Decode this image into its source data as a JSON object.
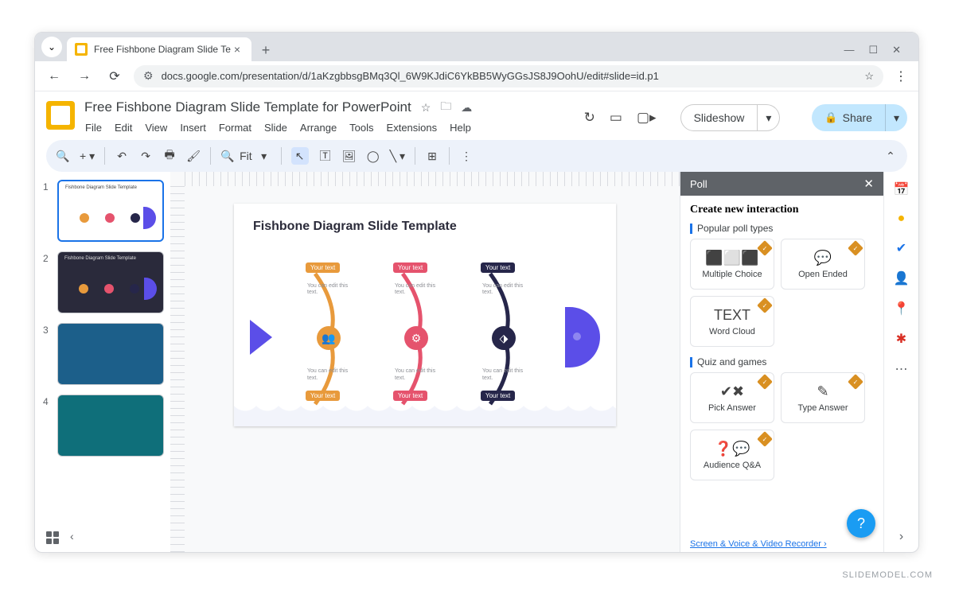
{
  "browser": {
    "tab_title": "Free Fishbone Diagram Slide Te",
    "url": "docs.google.com/presentation/d/1aKzgbbsgBMq3Ql_6W9KJdiC6YkBB5WyGGsJS8J9OohU/edit#slide=id.p1"
  },
  "doc": {
    "title": "Free Fishbone Diagram Slide Template for PowerPoint",
    "menus": [
      "File",
      "Edit",
      "View",
      "Insert",
      "Format",
      "Slide",
      "Arrange",
      "Tools",
      "Extensions",
      "Help"
    ],
    "slideshow_label": "Slideshow",
    "share_label": "Share",
    "zoom_label": "Fit"
  },
  "slide": {
    "heading": "Fishbone Diagram Slide Template",
    "bones": [
      {
        "color": "#e89a3c",
        "node_glyph": "👥",
        "top_tag": "Your text",
        "bottom_tag": "Your text",
        "hint": "You can edit this text."
      },
      {
        "color": "#e5536d",
        "node_glyph": "⚙",
        "top_tag": "Your text",
        "bottom_tag": "Your text",
        "hint": "You can edit this text."
      },
      {
        "color": "#26264a",
        "node_glyph": "⬗",
        "top_tag": "Your text",
        "bottom_tag": "Your text",
        "hint": "You can edit this text."
      }
    ]
  },
  "filmstrip": {
    "slides": [
      1,
      2,
      3,
      4
    ],
    "selected": 1
  },
  "poll_panel": {
    "title": "Poll",
    "heading": "Create new interaction",
    "section1": "Popular poll types",
    "section2": "Quiz and games",
    "cards1": [
      {
        "label": "Multiple Choice",
        "glyph": "⬛⬜⬛"
      },
      {
        "label": "Open Ended",
        "glyph": "💬"
      },
      {
        "label": "Word Cloud",
        "glyph": "TEXT"
      }
    ],
    "cards2": [
      {
        "label": "Pick Answer",
        "glyph": "✔✖"
      },
      {
        "label": "Type Answer",
        "glyph": "✎"
      },
      {
        "label": "Audience Q&A",
        "glyph": "❓💬"
      }
    ],
    "footer_link": "Screen & Voice & Video Recorder  ›"
  },
  "right_rail": {
    "items": [
      {
        "name": "calendar-icon",
        "glyph": "📅",
        "color": "#1a73e8"
      },
      {
        "name": "keep-icon",
        "glyph": "●",
        "color": "#f5b400"
      },
      {
        "name": "tasks-icon",
        "glyph": "✔",
        "color": "#1a73e8"
      },
      {
        "name": "contacts-icon",
        "glyph": "👤",
        "color": "#1a73e8"
      },
      {
        "name": "maps-icon",
        "glyph": "📍",
        "color": "#34a853"
      },
      {
        "name": "addon-icon",
        "glyph": "✱",
        "color": "#d93025"
      },
      {
        "name": "more-icon",
        "glyph": "⋯",
        "color": "#5f6368"
      }
    ]
  },
  "watermark": "SLIDEMODEL.COM"
}
